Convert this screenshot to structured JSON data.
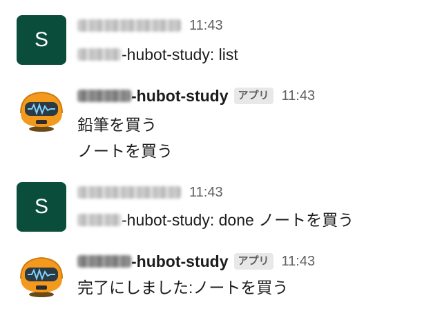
{
  "messages": [
    {
      "sender_type": "user",
      "avatar_letter": "S",
      "avatar_color": "#0b4d3b",
      "time": "11:43",
      "text_suffix": "-hubot-study: list"
    },
    {
      "sender_type": "bot",
      "name_suffix": "-hubot-study",
      "badge": "アプリ",
      "time": "11:43",
      "lines": [
        "鉛筆を買う",
        "ノートを買う"
      ]
    },
    {
      "sender_type": "user",
      "avatar_letter": "S",
      "avatar_color": "#0b4d3b",
      "time": "11:43",
      "text_suffix": "-hubot-study: done ノートを買う"
    },
    {
      "sender_type": "bot",
      "name_suffix": "-hubot-study",
      "badge": "アプリ",
      "time": "11:43",
      "lines": [
        "完了にしました:ノートを買う"
      ]
    }
  ],
  "colors": {
    "bot_avatar": "#f39a1e",
    "text": "#1d1c1d",
    "timestamp": "#616061"
  }
}
